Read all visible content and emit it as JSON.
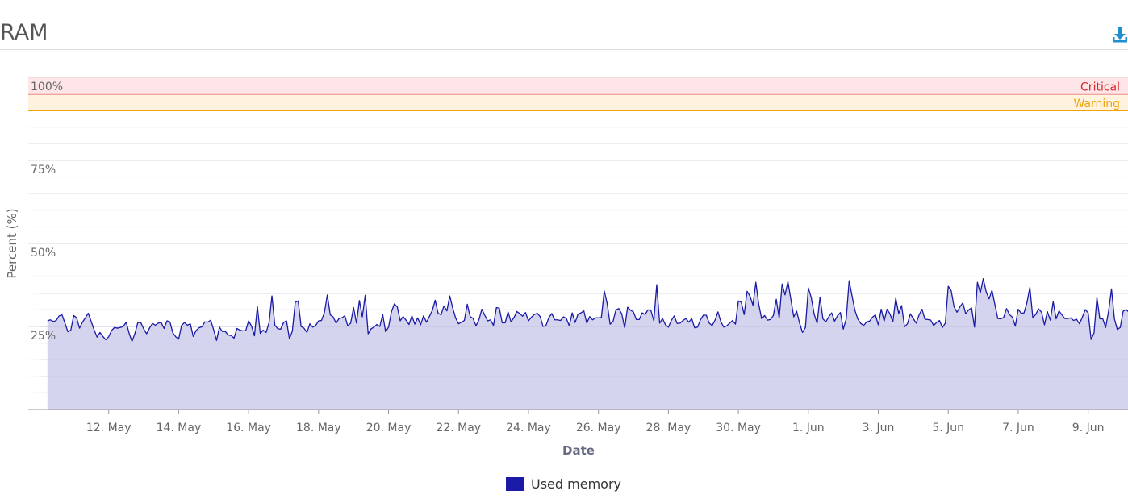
{
  "header": {
    "title": "RAM",
    "download_icon": "download-icon"
  },
  "colors": {
    "series": "#1a1aa6",
    "series_fill": "#d2d2ee",
    "critical": "#d62728",
    "critical_band": "#fde5e8",
    "warning": "#f0a30a",
    "warning_band": "#fff3df",
    "download": "#1f8fd0"
  },
  "chart_data": {
    "type": "area",
    "title": "",
    "xlabel": "Date",
    "ylabel": "Percent (%)",
    "ylim": [
      0,
      100
    ],
    "y_ticks": [
      {
        "value": 100,
        "label": "100%"
      },
      {
        "value": 75,
        "label": "75%"
      },
      {
        "value": 50,
        "label": "50%"
      },
      {
        "value": 25,
        "label": "25%"
      }
    ],
    "x_range": [
      "2023-05-10",
      "2023-06-10"
    ],
    "x_ticks": [
      {
        "date": "2023-05-12",
        "label": "12. May"
      },
      {
        "date": "2023-05-14",
        "label": "14. May"
      },
      {
        "date": "2023-05-16",
        "label": "16. May"
      },
      {
        "date": "2023-05-18",
        "label": "18. May"
      },
      {
        "date": "2023-05-20",
        "label": "20. May"
      },
      {
        "date": "2023-05-22",
        "label": "22. May"
      },
      {
        "date": "2023-05-24",
        "label": "24. May"
      },
      {
        "date": "2023-05-26",
        "label": "26. May"
      },
      {
        "date": "2023-05-28",
        "label": "28. May"
      },
      {
        "date": "2023-05-30",
        "label": "30. May"
      },
      {
        "date": "2023-06-01",
        "label": "1. Jun"
      },
      {
        "date": "2023-06-03",
        "label": "3. Jun"
      },
      {
        "date": "2023-06-05",
        "label": "5. Jun"
      },
      {
        "date": "2023-06-07",
        "label": "7. Jun"
      },
      {
        "date": "2023-06-09",
        "label": "9. Jun"
      }
    ],
    "thresholds": [
      {
        "name": "Critical",
        "value": 95,
        "band_to": 100
      },
      {
        "name": "Warning",
        "value": 90,
        "band_to": 95
      }
    ],
    "grid": true,
    "legend_position": "bottom-center",
    "series": [
      {
        "name": "Used memory",
        "start": "2023-05-10T06:00",
        "interval_hours": 2,
        "values": [
          26.7,
          27.0,
          26.5,
          26.8,
          28.2,
          28.5,
          26.0,
          23.4,
          23.9,
          28.3,
          27.6,
          24.5,
          26.3,
          27.6,
          29.0,
          26.5,
          24.0,
          21.8,
          23.2,
          22.0,
          21.0,
          21.9,
          23.8,
          24.7,
          24.5,
          24.7,
          25.0,
          26.3,
          23.0,
          20.5,
          22.9,
          26.2,
          26.2,
          24.3,
          22.8,
          24.5,
          25.9,
          25.4,
          26.0,
          26.2,
          24.4,
          26.7,
          26.4,
          23.1,
          21.9,
          21.2,
          25.3,
          26.2,
          25.4,
          25.8,
          22.0,
          23.8,
          24.6,
          24.9,
          26.4,
          26.3,
          26.9,
          24.0,
          20.8,
          24.8,
          23.5,
          23.5,
          22.4,
          22.3,
          21.5,
          24.4,
          23.9,
          23.7,
          23.7,
          26.7,
          25.1,
          22.2,
          31.0,
          22.9,
          23.9,
          23.2,
          26.1,
          34.2,
          25.4,
          24.3,
          24.2,
          26.2,
          26.7,
          21.3,
          23.6,
          32.3,
          32.7,
          25.0,
          24.5,
          23.2,
          25.8,
          24.8,
          25.3,
          26.7,
          26.8,
          29.2,
          34.5,
          28.5,
          27.9,
          26.0,
          27.4,
          27.6,
          28.2,
          25.2,
          26.0,
          30.7,
          26.0,
          32.8,
          27.9,
          34.4,
          22.8,
          24.3,
          24.8,
          25.6,
          25.0,
          28.6,
          23.4,
          24.8,
          29.5,
          31.8,
          30.9,
          26.7,
          28.0,
          26.9,
          25.6,
          28.2,
          25.7,
          27.6,
          25.5,
          28.2,
          26.3,
          28.0,
          29.8,
          32.9,
          29.0,
          28.5,
          31.2,
          29.7,
          34.2,
          30.6,
          27.6,
          25.8,
          26.3,
          26.8,
          31.7,
          28.0,
          27.4,
          25.2,
          27.0,
          30.2,
          28.4,
          26.7,
          27.0,
          25.3,
          30.7,
          30.5,
          26.1,
          26.1,
          29.4,
          26.4,
          27.6,
          29.5,
          28.9,
          28.1,
          29.2,
          26.7,
          27.8,
          28.6,
          29.0,
          28.0,
          25.0,
          25.3,
          27.7,
          28.9,
          27.0,
          27.0,
          26.8,
          27.9,
          27.4,
          25.2,
          29.1,
          26.2,
          28.7,
          29.1,
          29.7,
          26.0,
          28.0,
          27.0,
          27.6,
          27.6,
          27.7,
          35.7,
          31.9,
          25.7,
          26.5,
          30.0,
          30.4,
          28.8,
          24.6,
          30.8,
          29.9,
          29.4,
          27.1,
          27.1,
          29.1,
          28.6,
          30.0,
          29.8,
          26.7,
          37.6,
          26.0,
          27.4,
          25.5,
          24.8,
          26.8,
          28.2,
          25.9,
          26.0,
          26.8,
          27.4,
          26.3,
          27.4,
          24.6,
          24.8,
          27.0,
          28.4,
          28.4,
          26.0,
          25.3,
          26.9,
          29.4,
          26.4,
          24.8,
          25.2,
          26.0,
          26.8,
          25.7,
          32.7,
          32.3,
          28.6,
          35.6,
          34.1,
          31.4,
          38.3,
          31.6,
          27.3,
          28.3,
          26.9,
          27.1,
          28.3,
          33.2,
          27.5,
          37.8,
          34.5,
          38.5,
          33.2,
          27.9,
          29.6,
          26.0,
          23.2,
          24.7,
          36.6,
          33.7,
          28.7,
          26.0,
          33.8,
          27.3,
          26.4,
          27.9,
          29.1,
          26.6,
          28.2,
          29.2,
          24.2,
          27.3,
          38.8,
          34.2,
          29.8,
          27.2,
          25.9,
          25.3,
          26.4,
          26.6,
          27.8,
          28.5,
          25.5,
          30.2,
          26.6,
          30.2,
          28.8,
          26.4,
          33.5,
          28.9,
          31.3,
          24.9,
          25.8,
          28.8,
          27.4,
          26.0,
          28.5,
          30.2,
          27.2,
          27.1,
          26.9,
          25.3,
          26.2,
          26.8,
          24.7,
          26.0,
          37.1,
          35.8,
          30.9,
          29.3,
          30.9,
          32.1,
          28.8,
          30.0,
          30.6,
          24.8,
          38.3,
          35.1,
          39.4,
          35.5,
          33.3,
          35.9,
          31.6,
          27.4,
          27.3,
          27.7,
          30.4,
          28.6,
          27.8,
          25.1,
          30.2,
          29.0,
          29.1,
          32.2,
          36.8,
          27.7,
          28.6,
          30.3,
          29.3,
          25.5,
          29.5,
          26.9,
          32.5,
          27.3,
          29.7,
          28.5,
          27.4,
          27.4,
          27.6,
          26.8,
          27.2,
          25.8,
          27.8,
          30.1,
          29.1,
          21.1,
          23.0,
          33.7,
          27.3,
          27.3,
          24.7,
          29.6,
          36.3,
          27.3,
          24.1,
          24.7,
          29.6,
          30.1,
          29.3,
          30.2,
          33.3,
          27.5,
          25.4,
          24.3,
          25.8,
          29.1,
          27.3,
          25.8,
          25.0,
          25.9,
          27.0,
          29.5,
          29.1,
          27.6,
          26.3,
          26.1,
          28.0,
          30.2,
          28.6,
          27.8,
          24.5,
          26.9,
          28.3
        ]
      }
    ]
  },
  "legend": {
    "items": [
      {
        "label": "Used memory"
      }
    ]
  }
}
